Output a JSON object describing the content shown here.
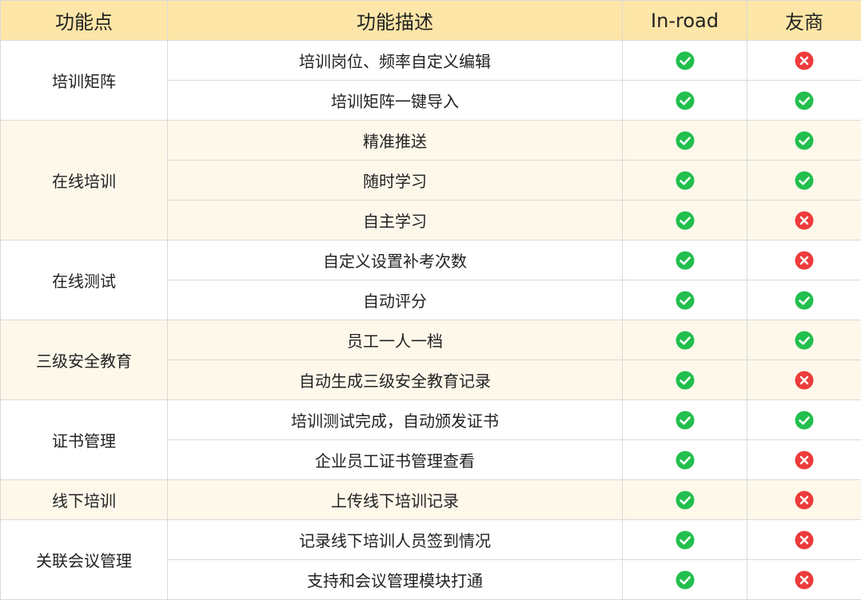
{
  "headers": [
    "功能点",
    "功能描述",
    "In-road",
    "友商"
  ],
  "colors": {
    "header_bg": "#fde6a7",
    "shaded_row_bg": "#fdf8ea",
    "check": "#22bf4e",
    "cross": "#ee3b3b"
  },
  "groups": [
    {
      "name": "培训矩阵",
      "shaded": false,
      "rows": [
        {
          "desc": "培训岗位、频率自定义编辑",
          "inroad": true,
          "competitor": false
        },
        {
          "desc": "培训矩阵一键导入",
          "inroad": true,
          "competitor": true
        }
      ]
    },
    {
      "name": "在线培训",
      "shaded": true,
      "rows": [
        {
          "desc": "精准推送",
          "inroad": true,
          "competitor": true
        },
        {
          "desc": "随时学习",
          "inroad": true,
          "competitor": true
        },
        {
          "desc": "自主学习",
          "inroad": true,
          "competitor": false
        }
      ]
    },
    {
      "name": "在线测试",
      "shaded": false,
      "rows": [
        {
          "desc": "自定义设置补考次数",
          "inroad": true,
          "competitor": false
        },
        {
          "desc": "自动评分",
          "inroad": true,
          "competitor": true
        }
      ]
    },
    {
      "name": "三级安全教育",
      "shaded": true,
      "rows": [
        {
          "desc": "员工一人一档",
          "inroad": true,
          "competitor": true
        },
        {
          "desc": "自动生成三级安全教育记录",
          "inroad": true,
          "competitor": false
        }
      ]
    },
    {
      "name": "证书管理",
      "shaded": false,
      "rows": [
        {
          "desc": "培训测试完成，自动颁发证书",
          "inroad": true,
          "competitor": true
        },
        {
          "desc": "企业员工证书管理查看",
          "inroad": true,
          "competitor": false
        }
      ]
    },
    {
      "name": "线下培训",
      "shaded": true,
      "rows": [
        {
          "desc": "上传线下培训记录",
          "inroad": true,
          "competitor": false
        }
      ]
    },
    {
      "name": "关联会议管理",
      "shaded": false,
      "rows": [
        {
          "desc": "记录线下培训人员签到情况",
          "inroad": true,
          "competitor": false
        },
        {
          "desc": "支持和会议管理模块打通",
          "inroad": true,
          "competitor": false
        }
      ]
    }
  ]
}
